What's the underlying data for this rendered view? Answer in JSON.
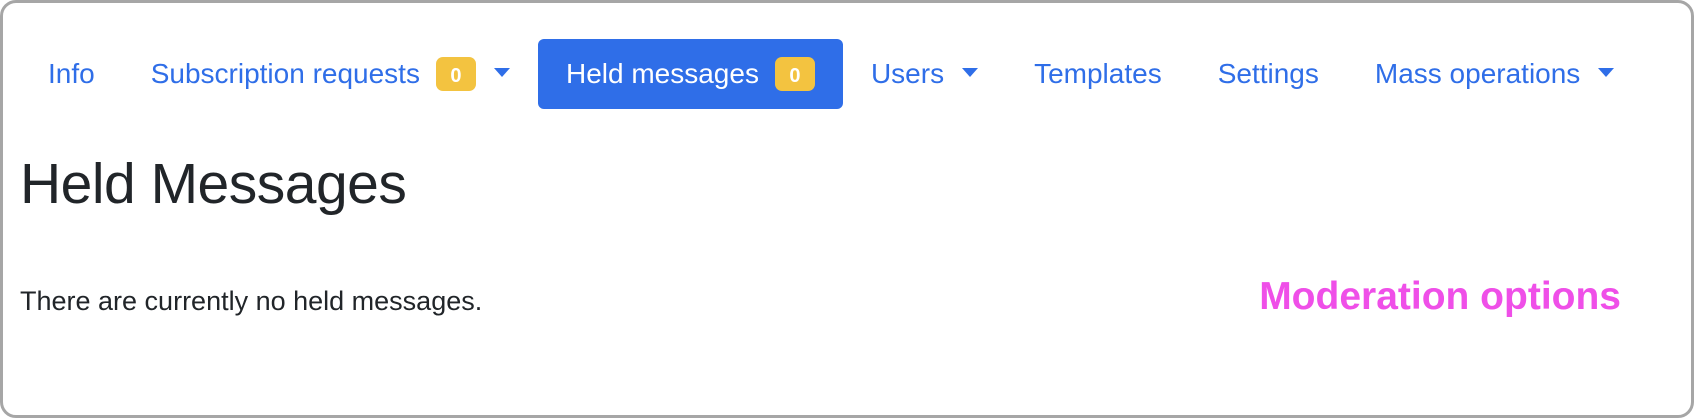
{
  "tabs": [
    {
      "label": "Info"
    },
    {
      "label": "Subscription requests",
      "badge": "0"
    },
    {
      "label": "Held messages",
      "badge": "0"
    },
    {
      "label": "Users"
    },
    {
      "label": "Templates"
    },
    {
      "label": "Settings"
    },
    {
      "label": "Mass operations"
    }
  ],
  "active_tab": "Held messages",
  "page": {
    "title": "Held Messages",
    "empty_message": "There are currently no held messages.",
    "moderation_heading": "Moderation options"
  },
  "colors": {
    "accent": "#2f6ee8",
    "badge": "#f3c340",
    "moderation_heading": "#ef4fe8",
    "text": "#212529"
  },
  "icons": {
    "dropdown": "caret-down-icon"
  }
}
